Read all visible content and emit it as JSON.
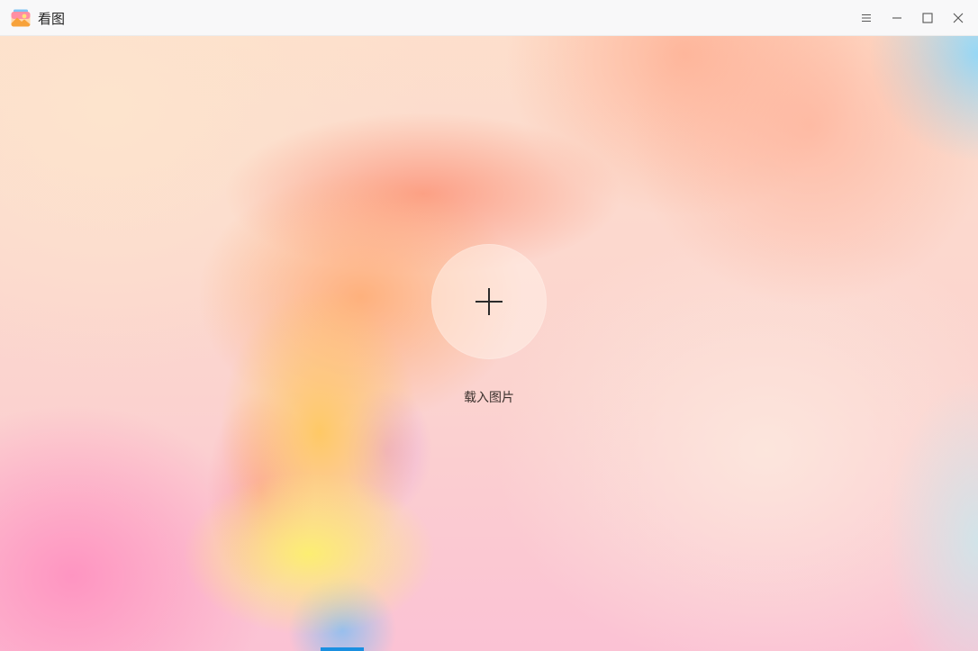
{
  "window": {
    "title": "看图",
    "controls": {
      "menu_icon": "menu-icon",
      "minimize_icon": "minimize-icon",
      "maximize_icon": "maximize-icon",
      "close_icon": "close-icon"
    }
  },
  "main": {
    "add_icon": "plus-icon",
    "load_label": "载入图片"
  },
  "colors": {
    "titlebar_bg": "#f8f8f9",
    "text": "#1f1f1f",
    "accent": "#1a8fe0"
  }
}
